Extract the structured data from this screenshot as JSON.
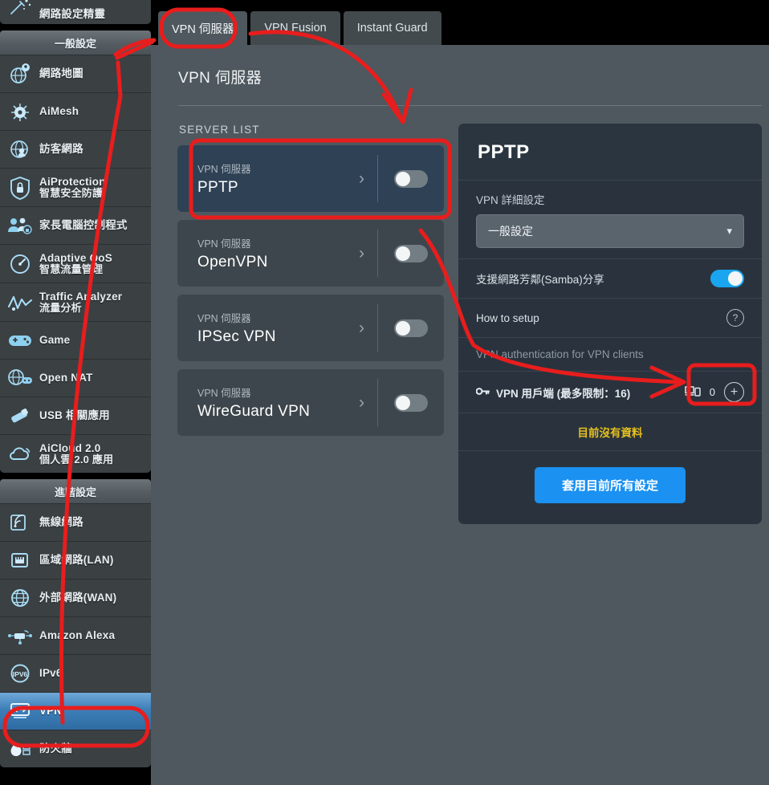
{
  "sidebar": {
    "top_item": {
      "label": "網路設定精靈",
      "icon": "wizard-icon"
    },
    "sections": [
      {
        "header": "一般設定",
        "items": [
          {
            "label": "網路地圖",
            "sub": "",
            "icon": "network-map-icon"
          },
          {
            "label": "AiMesh",
            "sub": "",
            "icon": "aimesh-icon"
          },
          {
            "label": "訪客網路",
            "sub": "",
            "icon": "guest-network-icon"
          },
          {
            "label": "AiProtection",
            "sub": "智慧安全防護",
            "icon": "shield-icon"
          },
          {
            "label": "家長電腦控制程式",
            "sub": "",
            "icon": "parental-control-icon"
          },
          {
            "label": "Adaptive QoS",
            "sub": "智慧流量管理",
            "icon": "qos-gauge-icon"
          },
          {
            "label": "Traffic Analyzer",
            "sub": "流量分析",
            "icon": "traffic-analyzer-icon"
          },
          {
            "label": "Game",
            "sub": "",
            "icon": "gamepad-icon"
          },
          {
            "label": "Open NAT",
            "sub": "",
            "icon": "open-nat-icon"
          },
          {
            "label": "USB 相關應用",
            "sub": "",
            "icon": "usb-icon"
          },
          {
            "label": "AiCloud 2.0",
            "sub": "個人雲 2.0 應用",
            "icon": "cloud-icon"
          }
        ]
      },
      {
        "header": "進階設定",
        "items": [
          {
            "label": "無線網路",
            "sub": "",
            "icon": "wifi-icon"
          },
          {
            "label": "區域網路(LAN)",
            "sub": "",
            "icon": "lan-icon"
          },
          {
            "label": "外部網路(WAN)",
            "sub": "",
            "icon": "wan-globe-icon"
          },
          {
            "label": "Amazon Alexa",
            "sub": "",
            "icon": "alexa-icon"
          },
          {
            "label": "IPv6",
            "sub": "",
            "icon": "ipv6-icon"
          },
          {
            "label": "VPN",
            "sub": "",
            "icon": "vpn-icon",
            "active": true
          },
          {
            "label": "防火牆",
            "sub": "",
            "icon": "firewall-icon"
          }
        ]
      }
    ]
  },
  "tabs": [
    {
      "label": "VPN 伺服器",
      "active": true
    },
    {
      "label": "VPN Fusion",
      "active": false
    },
    {
      "label": "Instant Guard",
      "active": false
    }
  ],
  "page": {
    "title": "VPN 伺服器"
  },
  "server_list": {
    "label": "SERVER LIST",
    "items": [
      {
        "kicker": "VPN 伺服器",
        "name": "PPTP",
        "enabled": false,
        "selected": true
      },
      {
        "kicker": "VPN 伺服器",
        "name": "OpenVPN",
        "enabled": false,
        "selected": false
      },
      {
        "kicker": "VPN 伺服器",
        "name": "IPSec VPN",
        "enabled": false,
        "selected": false
      },
      {
        "kicker": "VPN 伺服器",
        "name": "WireGuard VPN",
        "enabled": false,
        "selected": false
      }
    ]
  },
  "detail": {
    "title": "PPTP",
    "details_label": "VPN 詳細設定",
    "details_value": "一般設定",
    "samba_label": "支援網路芳鄰(Samba)分享",
    "samba_enabled": true,
    "how_to_setup": "How to setup",
    "auth_section": "VPN authentication for VPN clients",
    "clients_label": "VPN 用戶端 (最多限制：16)",
    "clients_count": "0",
    "no_data": "目前沒有資料",
    "apply_label": "套用目前所有設定"
  },
  "colors": {
    "accent_blue": "#1b91f2",
    "toggle_on": "#19a5ef",
    "warning_yellow": "#e6c01f",
    "content_bg": "#4e585e",
    "panel_bg": "#2a333d",
    "selected_card": "#2e4155",
    "annotation_red": "#e81d1d"
  }
}
